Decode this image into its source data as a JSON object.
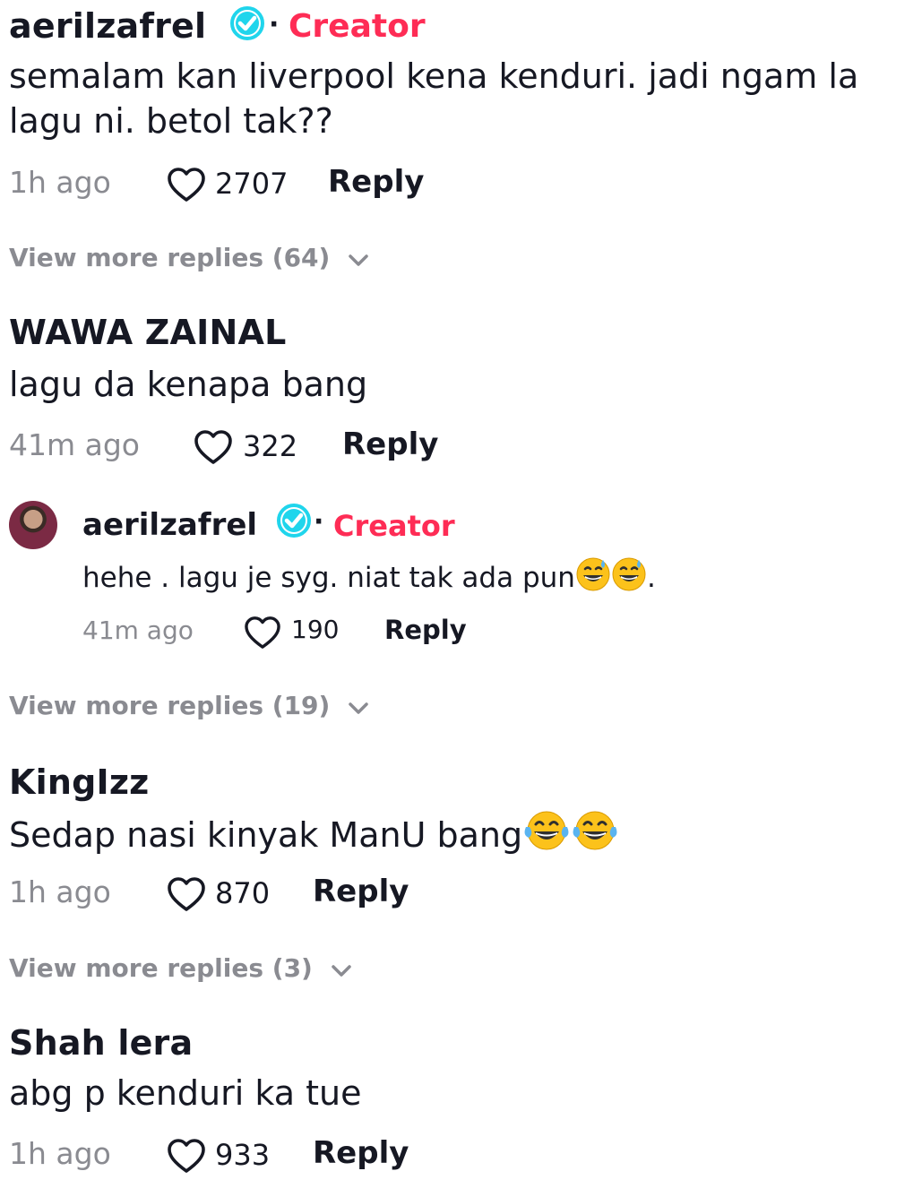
{
  "comments": [
    {
      "author": "aerilzafrel",
      "badge": "Creator",
      "text": "semalam kan liverpool kena kenduri. jadi ngam la lagu ni. betol tak??",
      "time": "1h ago",
      "likes": "2707",
      "reply": "Reply",
      "more_replies": "View more replies (64)"
    },
    {
      "author": "WAWA ZAINAL",
      "text": "lagu da kenapa bang",
      "time": "41m ago",
      "likes": "322",
      "reply": "Reply",
      "nested_reply": {
        "author": "aerilzafrel",
        "badge": "Creator",
        "text": "hehe . lagu je syg. niat tak ada pun",
        "text_suffix": ".",
        "emojis": [
          "grinning-face-with-sweat",
          "grinning-face-with-sweat"
        ],
        "time": "41m ago",
        "likes": "190",
        "reply": "Reply"
      },
      "more_replies": "View more replies (19)"
    },
    {
      "author": "KingIzz",
      "text": "Sedap nasi kinyak ManU bang",
      "emojis": [
        "face-with-tears-of-joy",
        "face-with-tears-of-joy"
      ],
      "time": "1h ago",
      "likes": "870",
      "reply": "Reply",
      "more_replies": "View more replies (3)"
    },
    {
      "author": "Shah lera",
      "text": "abg p kenduri ka tue",
      "time": "1h ago",
      "likes": "933",
      "reply": "Reply"
    }
  ],
  "colors": {
    "verified": "#20d5ec",
    "creator": "#fe2c55",
    "muted": "#8a8b91",
    "text": "#161823"
  }
}
